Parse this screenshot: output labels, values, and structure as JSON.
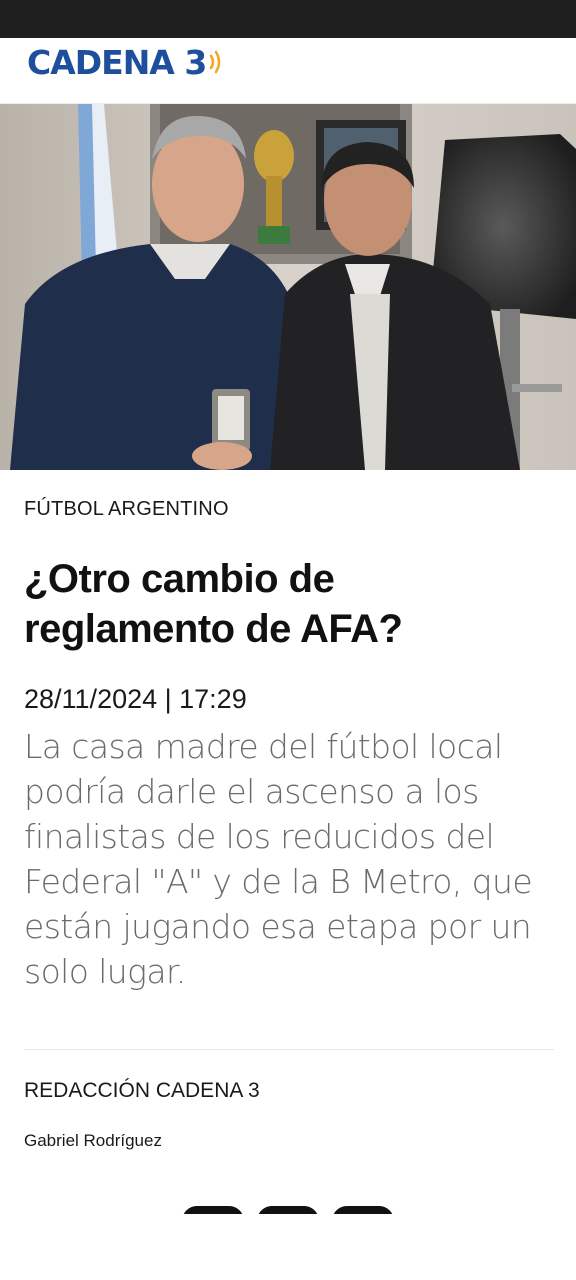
{
  "header": {
    "logo_text": "CADENA 3",
    "brand_color": "#1e4f9c",
    "accent_color": "#f5a623"
  },
  "hero": {
    "image": "photo-two-men-holding-award-box"
  },
  "article": {
    "category": "FÚTBOL ARGENTINO",
    "title": "¿Otro cambio de reglamento de AFA?",
    "datetime": "28/11/2024 | 17:29",
    "summary": "La casa madre del fútbol local podría darle el ascenso a los finalistas de los reducidos del Federal \"A\" y de la B Metro, que están jugando esa etapa por un solo lugar.",
    "byline_org": "REDACCIÓN CADENA 3",
    "author": "Gabriel Rodríguez"
  },
  "share": {
    "icons": [
      "share-icon-1",
      "share-icon-2",
      "share-icon-3"
    ]
  }
}
